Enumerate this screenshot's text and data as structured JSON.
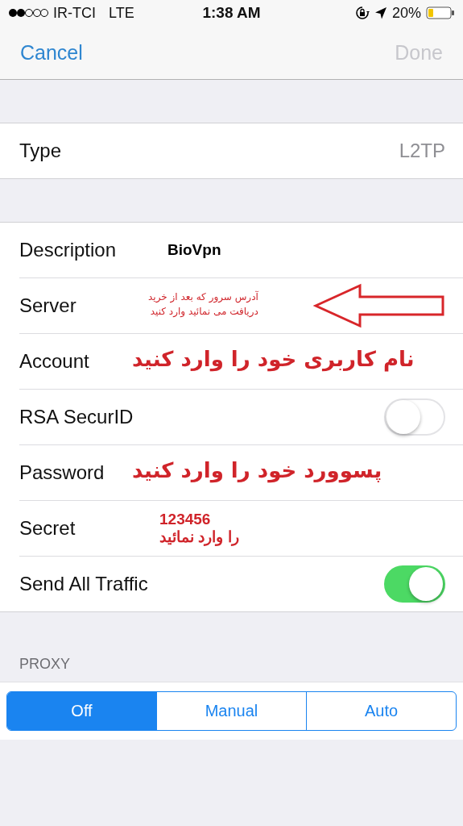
{
  "status_bar": {
    "carrier": "IR-TCI",
    "network": "LTE",
    "time": "1:38 AM",
    "battery": "20%"
  },
  "nav": {
    "cancel": "Cancel",
    "done": "Done",
    "done_disabled": true
  },
  "type_row": {
    "label": "Type",
    "value": "L2TP"
  },
  "rows": [
    {
      "label": "Description",
      "kind": "field",
      "value": "BioVpn"
    },
    {
      "label": "Server",
      "kind": "field",
      "annotation": {
        "kind": "callout",
        "lines": [
          "آدرس سرور که بعد از خرید",
          "دریافت می نمائید وارد کنید"
        ],
        "arrow": true
      }
    },
    {
      "label": "Account",
      "kind": "field",
      "annotation": {
        "kind": "headline",
        "lines": [
          "نام کاربری خود را وارد کنید"
        ]
      }
    },
    {
      "label": "RSA SecurID",
      "kind": "toggle",
      "on": false
    },
    {
      "label": "Password",
      "kind": "field",
      "annotation": {
        "kind": "headline",
        "lines": [
          "پسوورد خود را وارد کنید"
        ]
      }
    },
    {
      "label": "Secret",
      "kind": "field",
      "annotation": {
        "kind": "note",
        "lines": [
          "123456",
          "را وارد نمائید"
        ]
      }
    },
    {
      "label": "Send All Traffic",
      "kind": "toggle",
      "on": true
    }
  ],
  "proxy": {
    "header": "PROXY",
    "options": [
      {
        "label": "Off",
        "selected": true
      },
      {
        "label": "Manual",
        "selected": false
      },
      {
        "label": "Auto",
        "selected": false
      }
    ]
  }
}
